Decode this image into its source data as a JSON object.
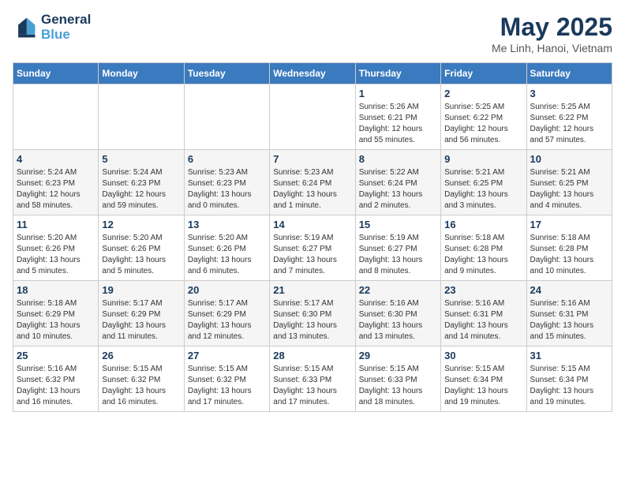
{
  "header": {
    "logo_line1": "General",
    "logo_line2": "Blue",
    "month_year": "May 2025",
    "location": "Me Linh, Hanoi, Vietnam"
  },
  "weekdays": [
    "Sunday",
    "Monday",
    "Tuesday",
    "Wednesday",
    "Thursday",
    "Friday",
    "Saturday"
  ],
  "weeks": [
    [
      {
        "day": "",
        "info": ""
      },
      {
        "day": "",
        "info": ""
      },
      {
        "day": "",
        "info": ""
      },
      {
        "day": "",
        "info": ""
      },
      {
        "day": "1",
        "info": "Sunrise: 5:26 AM\nSunset: 6:21 PM\nDaylight: 12 hours\nand 55 minutes."
      },
      {
        "day": "2",
        "info": "Sunrise: 5:25 AM\nSunset: 6:22 PM\nDaylight: 12 hours\nand 56 minutes."
      },
      {
        "day": "3",
        "info": "Sunrise: 5:25 AM\nSunset: 6:22 PM\nDaylight: 12 hours\nand 57 minutes."
      }
    ],
    [
      {
        "day": "4",
        "info": "Sunrise: 5:24 AM\nSunset: 6:23 PM\nDaylight: 12 hours\nand 58 minutes."
      },
      {
        "day": "5",
        "info": "Sunrise: 5:24 AM\nSunset: 6:23 PM\nDaylight: 12 hours\nand 59 minutes."
      },
      {
        "day": "6",
        "info": "Sunrise: 5:23 AM\nSunset: 6:23 PM\nDaylight: 13 hours\nand 0 minutes."
      },
      {
        "day": "7",
        "info": "Sunrise: 5:23 AM\nSunset: 6:24 PM\nDaylight: 13 hours\nand 1 minute."
      },
      {
        "day": "8",
        "info": "Sunrise: 5:22 AM\nSunset: 6:24 PM\nDaylight: 13 hours\nand 2 minutes."
      },
      {
        "day": "9",
        "info": "Sunrise: 5:21 AM\nSunset: 6:25 PM\nDaylight: 13 hours\nand 3 minutes."
      },
      {
        "day": "10",
        "info": "Sunrise: 5:21 AM\nSunset: 6:25 PM\nDaylight: 13 hours\nand 4 minutes."
      }
    ],
    [
      {
        "day": "11",
        "info": "Sunrise: 5:20 AM\nSunset: 6:26 PM\nDaylight: 13 hours\nand 5 minutes."
      },
      {
        "day": "12",
        "info": "Sunrise: 5:20 AM\nSunset: 6:26 PM\nDaylight: 13 hours\nand 5 minutes."
      },
      {
        "day": "13",
        "info": "Sunrise: 5:20 AM\nSunset: 6:26 PM\nDaylight: 13 hours\nand 6 minutes."
      },
      {
        "day": "14",
        "info": "Sunrise: 5:19 AM\nSunset: 6:27 PM\nDaylight: 13 hours\nand 7 minutes."
      },
      {
        "day": "15",
        "info": "Sunrise: 5:19 AM\nSunset: 6:27 PM\nDaylight: 13 hours\nand 8 minutes."
      },
      {
        "day": "16",
        "info": "Sunrise: 5:18 AM\nSunset: 6:28 PM\nDaylight: 13 hours\nand 9 minutes."
      },
      {
        "day": "17",
        "info": "Sunrise: 5:18 AM\nSunset: 6:28 PM\nDaylight: 13 hours\nand 10 minutes."
      }
    ],
    [
      {
        "day": "18",
        "info": "Sunrise: 5:18 AM\nSunset: 6:29 PM\nDaylight: 13 hours\nand 10 minutes."
      },
      {
        "day": "19",
        "info": "Sunrise: 5:17 AM\nSunset: 6:29 PM\nDaylight: 13 hours\nand 11 minutes."
      },
      {
        "day": "20",
        "info": "Sunrise: 5:17 AM\nSunset: 6:29 PM\nDaylight: 13 hours\nand 12 minutes."
      },
      {
        "day": "21",
        "info": "Sunrise: 5:17 AM\nSunset: 6:30 PM\nDaylight: 13 hours\nand 13 minutes."
      },
      {
        "day": "22",
        "info": "Sunrise: 5:16 AM\nSunset: 6:30 PM\nDaylight: 13 hours\nand 13 minutes."
      },
      {
        "day": "23",
        "info": "Sunrise: 5:16 AM\nSunset: 6:31 PM\nDaylight: 13 hours\nand 14 minutes."
      },
      {
        "day": "24",
        "info": "Sunrise: 5:16 AM\nSunset: 6:31 PM\nDaylight: 13 hours\nand 15 minutes."
      }
    ],
    [
      {
        "day": "25",
        "info": "Sunrise: 5:16 AM\nSunset: 6:32 PM\nDaylight: 13 hours\nand 16 minutes."
      },
      {
        "day": "26",
        "info": "Sunrise: 5:15 AM\nSunset: 6:32 PM\nDaylight: 13 hours\nand 16 minutes."
      },
      {
        "day": "27",
        "info": "Sunrise: 5:15 AM\nSunset: 6:32 PM\nDaylight: 13 hours\nand 17 minutes."
      },
      {
        "day": "28",
        "info": "Sunrise: 5:15 AM\nSunset: 6:33 PM\nDaylight: 13 hours\nand 17 minutes."
      },
      {
        "day": "29",
        "info": "Sunrise: 5:15 AM\nSunset: 6:33 PM\nDaylight: 13 hours\nand 18 minutes."
      },
      {
        "day": "30",
        "info": "Sunrise: 5:15 AM\nSunset: 6:34 PM\nDaylight: 13 hours\nand 19 minutes."
      },
      {
        "day": "31",
        "info": "Sunrise: 5:15 AM\nSunset: 6:34 PM\nDaylight: 13 hours\nand 19 minutes."
      }
    ]
  ]
}
